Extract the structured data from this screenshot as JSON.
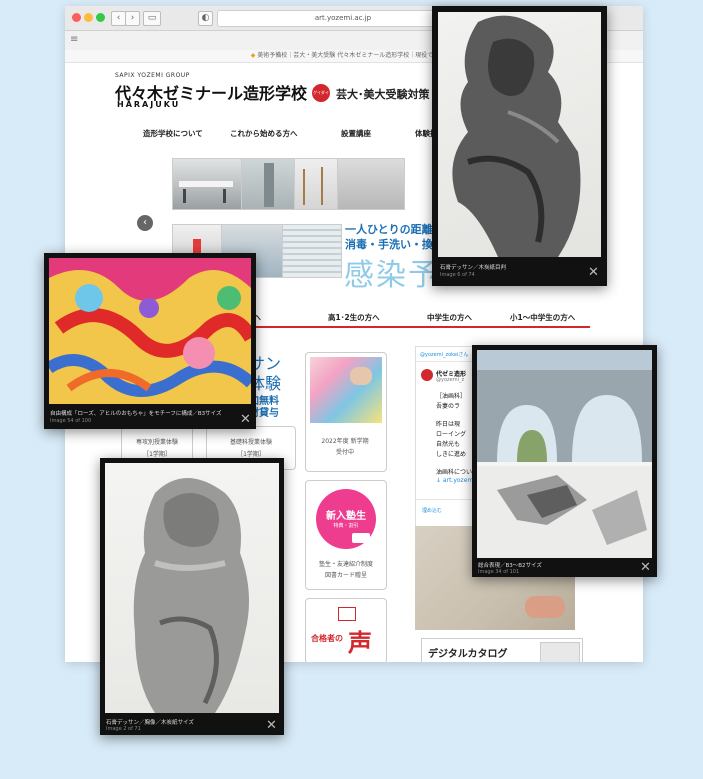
{
  "browser": {
    "url": "art.yozemi.ac.jp",
    "bookmark_bar_text": "美術予備校｜芸大・美大受験 代々木ゼミナール造形学校｜現役で美術大学"
  },
  "site": {
    "brand_small": "SAPIX YOZEMI GROUP",
    "brand_main": "代々木ゼミナール造形学校",
    "brand_sub": "HARAJUKU",
    "badge_text": "ゲイダイナビ",
    "tagline": "芸大･美大受験対策",
    "nav": [
      "造形学校について",
      "これから始める方へ",
      "設置講座",
      "体験授"
    ],
    "slider_text1": "一人ひとりの距離を",
    "slider_text2": "消毒・手洗い・換気",
    "slider_big": "感染予",
    "sub_nav": [
      "生の方へ",
      "高1･2生の方へ",
      "中学生の方へ",
      "小1〜中学生の方へ"
    ],
    "banner_lines": [
      "サン",
      "体験",
      "加無料",
      "材貸与"
    ],
    "cards": [
      {
        "line1": "専攻別授業体験",
        "line2": "［1学期］"
      },
      {
        "line1": "基礎科授業体験",
        "line2": "［1学期］"
      },
      {
        "line1": "2022年度 新学期",
        "line2": "受付中"
      }
    ],
    "pink_title": "新入塾生",
    "pink_sub": "特典・割引",
    "card_bottom": {
      "line1": "塾生・友達紹介制度",
      "line2": "図書カード贈呈"
    },
    "voice_top": "合格者の",
    "voice_label": "声",
    "twitter": {
      "handle": "@yozemi_zokeiさん",
      "name": "代ゼミ造形",
      "id": "@yozemi_z",
      "lines": [
        "［油画科］",
        "吾妻のラ",
        "昨日は現",
        "ローイング",
        "自然光も",
        "しきに進め",
        "油画科につい",
        "↓ art.yozem"
      ],
      "more": "埋め込む"
    },
    "catalog": "デジタルカタログ"
  },
  "overlays": [
    {
      "caption": "石膏デッサン／木炭紙目判",
      "counter": "Image 6 of 74"
    },
    {
      "caption": "自由構成「ローズ、アヒルのおもちゃ」をモチーフに構成／B3サイズ",
      "counter": "Image 54 of 100"
    },
    {
      "caption": "総合表現／B3〜B2サイズ",
      "counter": "Image 34 of 101"
    },
    {
      "caption": "石膏デッサン／胸像／木炭紙サイズ",
      "counter": "Image 2 of 71"
    }
  ],
  "colors": {
    "accent": "#d3272e",
    "bg": "#d8ebf8",
    "pink": "#ee3d8f"
  }
}
